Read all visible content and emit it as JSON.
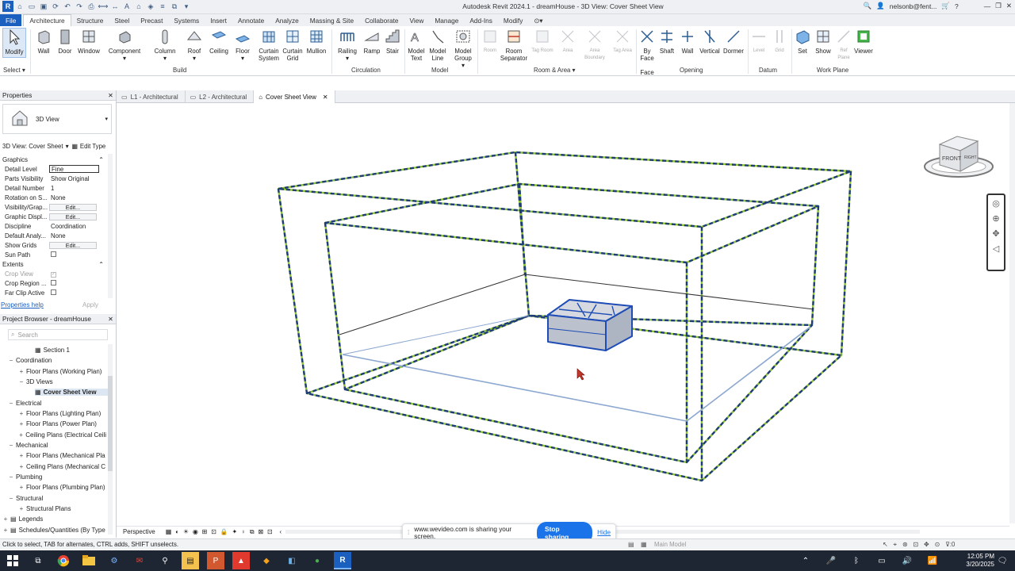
{
  "window": {
    "title": "Autodesk Revit 2024.1 - dreamHouse - 3D View: Cover Sheet View",
    "user": "nelsonb@fent...",
    "help": "?"
  },
  "menu_tabs": [
    "File",
    "Architecture",
    "Structure",
    "Steel",
    "Precast",
    "Systems",
    "Insert",
    "Annotate",
    "Analyze",
    "Massing & Site",
    "Collaborate",
    "View",
    "Manage",
    "Add-Ins",
    "Modify"
  ],
  "ribbon": {
    "select": {
      "modify": "Modify",
      "select": "Select"
    },
    "build": {
      "label": "Build",
      "items": [
        "Wall",
        "Door",
        "Window",
        "Component",
        "Column",
        "Roof",
        "Ceiling",
        "Floor",
        "Curtain System",
        "Curtain Grid",
        "Mullion"
      ]
    },
    "circulation": {
      "label": "Circulation",
      "items": [
        "Railing",
        "Ramp",
        "Stair"
      ]
    },
    "model": {
      "label": "Model",
      "items": [
        "Model Text",
        "Model Line",
        "Model Group"
      ]
    },
    "room_area": {
      "label": "Room & Area",
      "items": [
        "Room",
        "Room Separator",
        "Tag Room",
        "Area",
        "Area Boundary",
        "Tag Area"
      ]
    },
    "opening": {
      "label": "Opening",
      "items": [
        "By Face",
        "Shaft",
        "Wall",
        "Vertical",
        "Dormer"
      ]
    },
    "datum": {
      "label": "Datum",
      "items": [
        "Level",
        "Grid"
      ]
    },
    "work_plane": {
      "label": "Work Plane",
      "items": [
        "Set",
        "Show",
        "Ref Plane",
        "Viewer"
      ]
    }
  },
  "view_tabs": [
    "L1 - Architectural",
    "L2 - Architectural",
    "Cover Sheet View"
  ],
  "properties": {
    "title": "Properties",
    "type_name": "3D View",
    "selector": "3D View: Cover Sheet",
    "edit_type": "Edit Type",
    "groups": [
      "Graphics",
      "Extents"
    ],
    "rows": [
      {
        "k": "Detail Level",
        "v": "Fine"
      },
      {
        "k": "Parts Visibility",
        "v": "Show Original"
      },
      {
        "k": "Detail Number",
        "v": "1"
      },
      {
        "k": "Rotation on S...",
        "v": "None"
      },
      {
        "k": "Visibility/Grap...",
        "v": "Edit..."
      },
      {
        "k": "Graphic Displ...",
        "v": "Edit..."
      },
      {
        "k": "Discipline",
        "v": "Coordination"
      },
      {
        "k": "Default Analy...",
        "v": "None"
      },
      {
        "k": "Show Grids",
        "v": "Edit..."
      },
      {
        "k": "Sun Path",
        "v": ""
      }
    ],
    "extents": [
      {
        "k": "Crop View"
      },
      {
        "k": "Crop Region ..."
      },
      {
        "k": "Far Clip Active"
      }
    ],
    "help": "Properties help",
    "apply": "Apply"
  },
  "browser": {
    "title": "Project Browser - dreamHouse",
    "search_placeholder": "Search",
    "items": [
      "Section 1",
      "Coordination",
      "Floor Plans (Working Plan)",
      "3D Views",
      "Cover Sheet View",
      "Electrical",
      "Floor Plans (Lighting Plan)",
      "Floor Plans (Power Plan)",
      "Ceiling Plans (Electrical Ceili",
      "Mechanical",
      "Floor Plans (Mechanical Pla",
      "Ceiling Plans (Mechanical C",
      "Plumbing",
      "Floor Plans (Plumbing Plan)",
      "Structural",
      "Structural Plans",
      "Legends",
      "Schedules/Quantities (By Type"
    ]
  },
  "viewcube": {
    "front": "FRONT",
    "right": "RIGHT"
  },
  "view_control": {
    "mode": "Perspective"
  },
  "share": {
    "text": "www.wevideo.com is sharing your screen.",
    "stop": "Stop sharing",
    "hide": "Hide"
  },
  "status": {
    "text": "Click to select, TAB for alternates, CTRL adds, SHIFT unselects.",
    "model": "Main Model",
    "filter": ":0"
  },
  "clock": {
    "time": "12:05 PM",
    "date": "3/20/2025"
  }
}
